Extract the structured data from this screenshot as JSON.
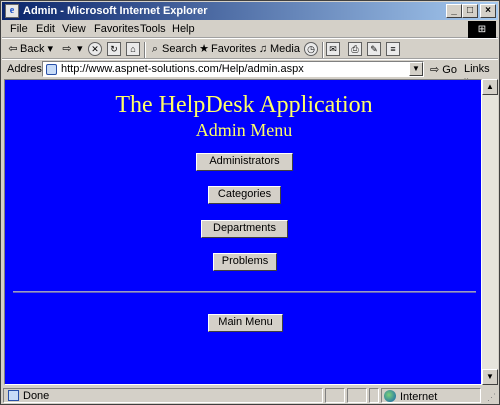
{
  "window": {
    "title": "Admin - Microsoft Internet Explorer",
    "controls": {
      "minimize": "_",
      "maximize": "□",
      "close": "×"
    }
  },
  "menubar": {
    "items": [
      "File",
      "Edit",
      "View",
      "Favorites",
      "Tools",
      "Help"
    ]
  },
  "toolbar": {
    "back_label": "Back",
    "search_label": "Search",
    "favorites_label": "Favorites",
    "media_label": "Media"
  },
  "address": {
    "label": "Address",
    "url": "http://www.aspnet-solutions.com/Help/admin.aspx",
    "go_label": "Go",
    "links_label": "Links"
  },
  "page": {
    "heading": "The HelpDesk Application",
    "subheading": "Admin Menu",
    "buttons": {
      "administrators": "Administrators",
      "categories": "Categories",
      "departments": "Departments",
      "problems": "Problems",
      "main_menu": "Main Menu"
    },
    "background_color": "#0000ff",
    "heading_color": "#ffff66"
  },
  "status": {
    "left_text": "Done",
    "zone_text": "Internet"
  }
}
